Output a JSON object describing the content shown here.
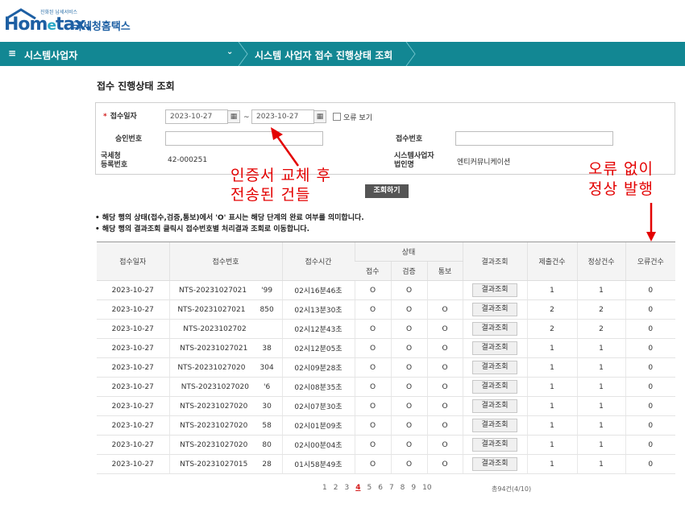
{
  "header": {
    "logo_tagline": "진화된 납세서비스",
    "logo_word_a": "Hom",
    "logo_word_e": "e",
    "logo_word_b": "tax.",
    "logo_korean": "국세청홈택스"
  },
  "nav": {
    "menu_label": "시스템사업자",
    "breadcrumb": "시스템 사업자 접수 진행상태 조회"
  },
  "page_title": "접수 진행상태 조회",
  "search": {
    "date_label": "접수일자",
    "required_mark": "*",
    "date_from": "2023-10-27",
    "date_to": "2023-10-27",
    "tilde": "~",
    "error_view_label": "오류 보기",
    "approval_no_label": "승인번호",
    "approval_no_value": "",
    "receipt_no_label": "접수번호",
    "receipt_no_value": "",
    "nts_reg_label_1": "국세청",
    "nts_reg_label_2": "등록번호",
    "nts_reg_value": "42-000251",
    "sys_biz_label_1": "시스템사업자",
    "sys_biz_label_2": "법인명",
    "sys_biz_value": "엔티커뮤니케이션",
    "search_button": "조회하기"
  },
  "notes": [
    "• 해당 행의 상태(접수,검증,통보)에서 'O' 표시는 해당 단계의 완료 여부를 의미합니다.",
    "• 해당 행의 결과조회 클릭시 접수번호별 처리결과 조회로 이동합니다."
  ],
  "table": {
    "headers": {
      "date": "접수일자",
      "receipt_no": "접수번호",
      "time": "접수시간",
      "status": "상태",
      "status_receipt": "접수",
      "status_verify": "검증",
      "status_notify": "통보",
      "result": "결과조회",
      "submitted": "제출건수",
      "normal": "정상건수",
      "errors": "오류건수"
    },
    "result_button": "결과조회",
    "rows": [
      {
        "date": "2023-10-27",
        "no": "NTS-20231027021    '99",
        "time": "02시16분46초",
        "s1": "O",
        "s2": "O",
        "s3": "",
        "sub": "1",
        "norm": "1",
        "err": "0"
      },
      {
        "date": "2023-10-27",
        "no": "NTS-20231027021    850",
        "time": "02시13분30초",
        "s1": "O",
        "s2": "O",
        "s3": "O",
        "sub": "2",
        "norm": "2",
        "err": "0"
      },
      {
        "date": "2023-10-27",
        "no": "NTS-2023102702      ",
        "time": "02시12분43초",
        "s1": "O",
        "s2": "O",
        "s3": "O",
        "sub": "2",
        "norm": "2",
        "err": "0"
      },
      {
        "date": "2023-10-27",
        "no": "NTS-20231027021    38",
        "time": "02시12분05초",
        "s1": "O",
        "s2": "O",
        "s3": "O",
        "sub": "1",
        "norm": "1",
        "err": "0"
      },
      {
        "date": "2023-10-27",
        "no": "NTS-20231027020    304",
        "time": "02시09분28초",
        "s1": "O",
        "s2": "O",
        "s3": "O",
        "sub": "1",
        "norm": "1",
        "err": "0"
      },
      {
        "date": "2023-10-27",
        "no": "NTS-20231027020    '6",
        "time": "02시08분35초",
        "s1": "O",
        "s2": "O",
        "s3": "O",
        "sub": "1",
        "norm": "1",
        "err": "0"
      },
      {
        "date": "2023-10-27",
        "no": "NTS-20231027020    30",
        "time": "02시07분30초",
        "s1": "O",
        "s2": "O",
        "s3": "O",
        "sub": "1",
        "norm": "1",
        "err": "0"
      },
      {
        "date": "2023-10-27",
        "no": "NTS-20231027020    58",
        "time": "02시01분09초",
        "s1": "O",
        "s2": "O",
        "s3": "O",
        "sub": "1",
        "norm": "1",
        "err": "0"
      },
      {
        "date": "2023-10-27",
        "no": "NTS-20231027020    80",
        "time": "02시00분04초",
        "s1": "O",
        "s2": "O",
        "s3": "O",
        "sub": "1",
        "norm": "1",
        "err": "0"
      },
      {
        "date": "2023-10-27",
        "no": "NTS-20231027015    28",
        "time": "01시58분49초",
        "s1": "O",
        "s2": "O",
        "s3": "O",
        "sub": "1",
        "norm": "1",
        "err": "0"
      }
    ]
  },
  "pagination": {
    "pages": [
      "1",
      "2",
      "3",
      "4",
      "5",
      "6",
      "7",
      "8",
      "9",
      "10"
    ],
    "current": "4",
    "total": "총94건(4/10)"
  },
  "annotations": {
    "left_line1": "인증서 교체 후",
    "left_line2": "전송된 건들",
    "right_line1": "오류 없이",
    "right_line2": "정상 발행",
    "color": "#e30000"
  }
}
